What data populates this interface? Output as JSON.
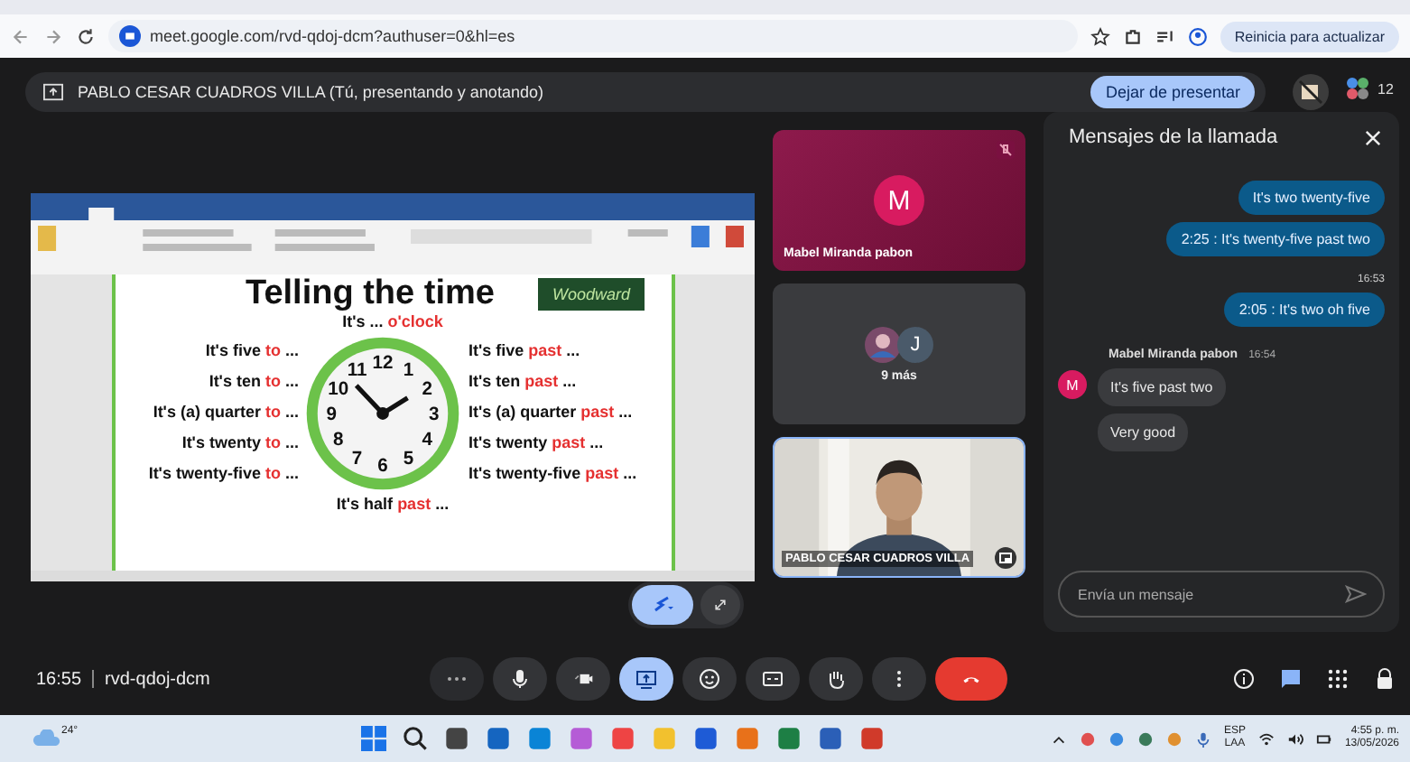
{
  "browser": {
    "url": "meet.google.com/rvd-qdoj-dcm?authuser=0&hl=es",
    "update_button": "Reinicia para actualizar"
  },
  "presenter_bar": {
    "text": "PABLO CESAR CUADROS VILLA (Tú, presentando y anotando)",
    "stop_button": "Dejar de presentar",
    "participants": "12"
  },
  "document": {
    "title": "Telling the time",
    "logo": "Woodward",
    "top": {
      "text": "It's ... ",
      "accent": "o'clock"
    },
    "left": [
      {
        "text": "It's five ",
        "accent": "to",
        "rest": " ..."
      },
      {
        "text": "It's ten ",
        "accent": "to",
        "rest": " ..."
      },
      {
        "text": "It's (a) quarter ",
        "accent": "to",
        "rest": " ..."
      },
      {
        "text": "It's twenty ",
        "accent": "to",
        "rest": " ..."
      },
      {
        "text": "It's twenty-five ",
        "accent": "to",
        "rest": " ..."
      }
    ],
    "right": [
      {
        "text": "It's five ",
        "accent": "past",
        "rest": " ..."
      },
      {
        "text": "It's ten ",
        "accent": "past",
        "rest": " ..."
      },
      {
        "text": "It's (a) quarter ",
        "accent": "past",
        "rest": " ..."
      },
      {
        "text": "It's twenty ",
        "accent": "past",
        "rest": " ..."
      },
      {
        "text": "It's twenty-five ",
        "accent": "past",
        "rest": " ..."
      }
    ],
    "bottom": {
      "text": "It's half ",
      "accent": "past",
      "rest": " ..."
    },
    "clock_numbers": [
      "11",
      "12",
      "1",
      "10",
      "2",
      "9",
      "3",
      "8",
      "4",
      "7",
      "5",
      "6"
    ]
  },
  "tiles": [
    {
      "kind": "avatar",
      "name": "Mabel Miranda pabon",
      "initial": "M",
      "muted": true
    },
    {
      "kind": "group",
      "initial": "J",
      "caption": "9 más"
    },
    {
      "kind": "video",
      "name": "PABLO CESAR CUADROS VILLA"
    }
  ],
  "chat": {
    "title": "Mensajes de la llamada",
    "placeholder": "Envía un mensaje",
    "items": [
      {
        "kind": "sent",
        "text": "It's two twenty-five"
      },
      {
        "kind": "sent",
        "text": "2:25 : It's twenty-five past two"
      },
      {
        "kind": "time",
        "text": "16:53"
      },
      {
        "kind": "sent",
        "text": "2:05 : It's two oh five"
      },
      {
        "kind": "received",
        "sender": "Mabel Miranda pabon",
        "time": "16:54",
        "initial": "M",
        "messages": [
          "It's five past two",
          "Very good"
        ]
      }
    ]
  },
  "bottom_bar": {
    "time": "16:55",
    "code": "rvd-qdoj-dcm",
    "controls": [
      {
        "kind": "more",
        "selected": false
      },
      {
        "kind": "mic",
        "selected": false
      },
      {
        "kind": "camera",
        "selected": false
      },
      {
        "kind": "present",
        "selected": true
      },
      {
        "kind": "emoji",
        "selected": false
      },
      {
        "kind": "captions",
        "selected": false
      },
      {
        "kind": "hand",
        "selected": false
      },
      {
        "kind": "menu",
        "selected": false
      },
      {
        "kind": "hangup",
        "selected": false
      }
    ]
  },
  "taskbar": {
    "temperature": "24°",
    "language": "ESP",
    "layout": "LAA",
    "time": "4:55 p. m.",
    "date": "13/05/2026"
  }
}
